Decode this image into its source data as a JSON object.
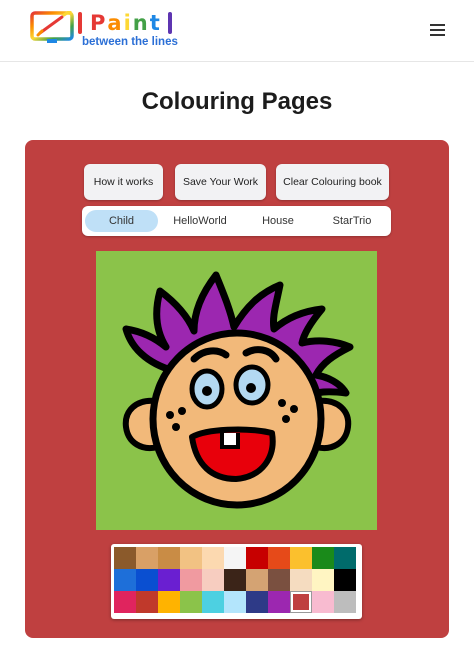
{
  "header": {
    "logo": {
      "title": "Paint",
      "title_letter_colors": [
        "#e53935",
        "#fb8c00",
        "#fdd835",
        "#43a047",
        "#1e88e5"
      ],
      "subtitle": "between the lines",
      "subtitle_color": "#2b6fd6"
    },
    "icons": {
      "theme_toggle": "moon-icon",
      "menu": "hamburger-menu-icon"
    }
  },
  "page": {
    "title": "Colouring Pages"
  },
  "panel": {
    "background": "#bf4040",
    "buttons": {
      "how_it_works": "How it works",
      "save": "Save Your Work",
      "clear": "Clear Colouring book"
    },
    "tabs": [
      {
        "label": "Child",
        "active": true
      },
      {
        "label": "HelloWorld",
        "active": false
      },
      {
        "label": "House",
        "active": false
      },
      {
        "label": "StarTrio",
        "active": false
      }
    ],
    "canvas": {
      "background": "#8bc34a",
      "hair_color": "#9c27b0",
      "skin_color": "#f2b97a",
      "eye_color": "#b3d9f2",
      "mouth_color": "#e8000b"
    },
    "palette": {
      "selected_index": 30,
      "colors": [
        "#8b5a2b",
        "#d9a066",
        "#c98c45",
        "#f2c283",
        "#fcd9b0",
        "#f5f5f5",
        "#c70000",
        "#e64a19",
        "#fbc02d",
        "#1a8a1a",
        "#006b6b",
        "#1e6fd9",
        "#0a4fd1",
        "#6a1fd1",
        "#f09aa0",
        "#f7cdc0",
        "#3b2418",
        "#d4a373",
        "#7a5040",
        "#f5dcc0",
        "#fff5c2",
        "#000000",
        "#e0245e",
        "#c0392b",
        "#ffb300",
        "#8bc34a",
        "#4dd0e1",
        "#b3e5fc",
        "#2e3a87",
        "#9c27b0",
        "#bf4040",
        "#f8bbd0",
        "#bdbdbd"
      ]
    }
  }
}
